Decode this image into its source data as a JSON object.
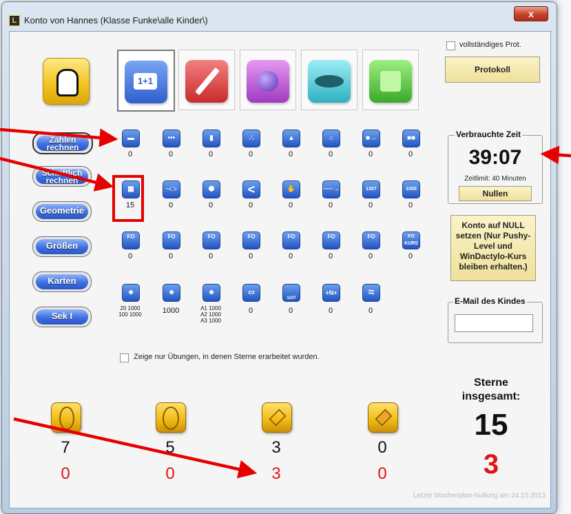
{
  "window": {
    "title": "Konto von Hannes (Klasse Funke\\alle Kinder\\)",
    "app_icon": "L",
    "close": "x"
  },
  "top_right": {
    "protocol_checkbox_label": "vollständiges Prot.",
    "protocol_button": "Protokoll"
  },
  "categories": [
    {
      "name": "addition-tab",
      "label": "1+1",
      "color": "#2f5fd0"
    },
    {
      "name": "pencil-tab",
      "color": "#d23a3a"
    },
    {
      "name": "globe-tab",
      "color": "#b04ac8"
    },
    {
      "name": "mouth-tab",
      "color": "#3ab8c8"
    },
    {
      "name": "puzzle-tab",
      "color": "#49b83a"
    }
  ],
  "sidebar": [
    {
      "label": "Zahlen rechnen"
    },
    {
      "label": "Schriftlich rechnen"
    },
    {
      "label": "Geometrie"
    },
    {
      "label": "Größen"
    },
    {
      "label": "Karten"
    },
    {
      "label": "Sek I"
    }
  ],
  "exercises": {
    "row1": [
      {
        "icon": "blocks-icon",
        "count": "0"
      },
      {
        "icon": "dots-icon",
        "count": "0"
      },
      {
        "icon": "cube-icon",
        "count": "0"
      },
      {
        "icon": "dot-cluster-icon",
        "count": "0"
      },
      {
        "icon": "triangle-icon",
        "count": "0"
      },
      {
        "icon": "house-icon",
        "count": "0"
      },
      {
        "icon": "arrow-block-icon",
        "count": "0"
      },
      {
        "icon": "double-block-icon",
        "count": "0"
      }
    ],
    "row2": [
      {
        "icon": "grid-icon",
        "count": "15"
      },
      {
        "icon": "number-line-icon",
        "count": "0"
      },
      {
        "icon": "ball-icon",
        "count": "0"
      },
      {
        "icon": "less-than-icon",
        "count": "0"
      },
      {
        "icon": "hand-icon",
        "count": "0"
      },
      {
        "icon": "ruler-icon",
        "count": "0"
      },
      {
        "icon": "1357-icon",
        "count": "0",
        "glyph": "1357"
      },
      {
        "icon": "1000-icon",
        "count": "0",
        "glyph": "1000"
      }
    ],
    "row3": [
      {
        "icon": "fo-eye-icon",
        "count": "0",
        "glyph": "FO"
      },
      {
        "icon": "fo-plus-icon",
        "count": "0",
        "glyph": "FO"
      },
      {
        "icon": "fo-minus-icon",
        "count": "0",
        "glyph": "FO"
      },
      {
        "icon": "fo-hearts-icon",
        "count": "0",
        "glyph": "FO"
      },
      {
        "icon": "fo-ladder-icon",
        "count": "0",
        "glyph": "FO"
      },
      {
        "icon": "fo-grid-icon",
        "count": "0",
        "glyph": "FO"
      },
      {
        "icon": "fo-arrow-icon",
        "count": "0",
        "glyph": "FO"
      },
      {
        "icon": "fo-kurs-icon",
        "count": "0",
        "glyph": "FO KURS"
      }
    ],
    "row4": [
      {
        "icon": "smiley-plus-icon",
        "count_lines": [
          "20 1000",
          "100 1000"
        ]
      },
      {
        "icon": "smiley-icon",
        "count": "1000"
      },
      {
        "icon": "smiley-arrow-icon",
        "count_lines": [
          "A1 1000",
          "A2 1000",
          "A3 1000"
        ]
      },
      {
        "icon": "card-icon",
        "count": "0"
      },
      {
        "icon": "bottle-icon",
        "count": "0",
        "glyph": "1247"
      },
      {
        "icon": "plus-n-icon",
        "count": "0",
        "glyph": "+N+"
      },
      {
        "icon": "wave-icon",
        "count": "0",
        "glyph": "≈"
      }
    ]
  },
  "filter_checkbox_label": "Zeige nur Übungen, in denen Sterne erarbeitet wurden.",
  "time_panel": {
    "title": "Verbrauchte Zeit",
    "time": "39:07",
    "limit": "Zeitlimit: 40 Minuten",
    "reset_button": "Nullen"
  },
  "reset_account_button": "Konto auf NULL setzen (Nur Pushy-Level und WinDactylo-Kurs bleiben erhalten.)",
  "email": {
    "title": "E-Mail des Kindes",
    "value": ""
  },
  "stars": [
    {
      "icon": "oval-coin-icon",
      "count": "7",
      "new": "0"
    },
    {
      "icon": "double-oval-coin-icon",
      "count": "5",
      "new": "0"
    },
    {
      "icon": "star-coin-icon",
      "count": "3",
      "new": "3"
    },
    {
      "icon": "gem-coin-icon",
      "count": "0",
      "new": "0"
    }
  ],
  "total": {
    "label": "Sterne insgesamt:",
    "count": "15",
    "new": "3"
  },
  "footer": "Letzte Wochenplan-Nullung am 24.10.2013",
  "colors": {
    "annotation": "#e60000",
    "highlight": "#e60000",
    "red_numbers": "#e01414"
  }
}
